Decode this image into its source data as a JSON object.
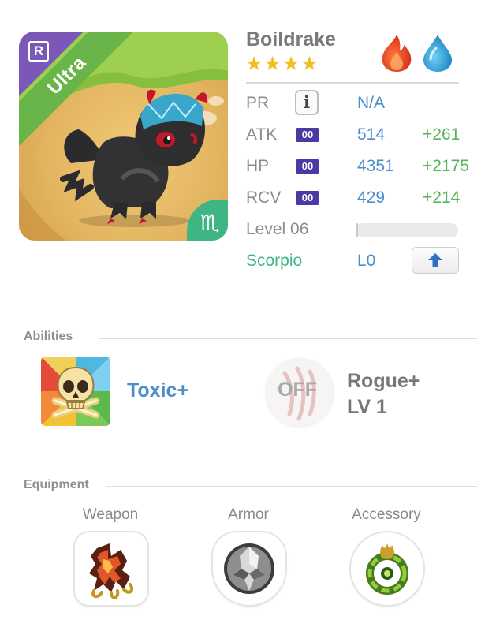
{
  "monster": {
    "name": "Boildrake",
    "stars": "★★★★",
    "star_count": 4,
    "rarity": "Ultra",
    "rank_badge": "R",
    "zodiac_symbol": "♏",
    "elements": [
      "fire-icon",
      "water-icon"
    ],
    "colors": {
      "fire": "#e8462a",
      "water": "#39a8de",
      "rarity_ribbon": "#69b54a",
      "rank_corner": "#7b57b8",
      "zodiac": "#3fb584"
    }
  },
  "stats": {
    "pr": {
      "label": "PR",
      "value": "N/A"
    },
    "atk": {
      "label": "ATK",
      "tag": "00",
      "value": "514",
      "bonus": "+261"
    },
    "hp": {
      "label": "HP",
      "tag": "00",
      "value": "4351",
      "bonus": "+2175"
    },
    "rcv": {
      "label": "RCV",
      "tag": "00",
      "value": "429",
      "bonus": "+214"
    },
    "level": {
      "label": "Level 06",
      "progress": 0.02
    },
    "zodiac": {
      "label": "Scorpio",
      "value": "L0"
    }
  },
  "abilities": {
    "title": "Abilities",
    "primary": {
      "name": "Toxic+",
      "icon": "skull-icon"
    },
    "secondary": {
      "status": "OFF",
      "name": "Rogue+",
      "level": "LV 1",
      "icon": "claw-icon"
    }
  },
  "equipment": {
    "title": "Equipment",
    "slots": [
      {
        "label": "Weapon",
        "icon": "claw-weapon-icon"
      },
      {
        "label": "Armor",
        "icon": "shield-armor-icon"
      },
      {
        "label": "Accessory",
        "icon": "amulet-icon"
      }
    ]
  }
}
